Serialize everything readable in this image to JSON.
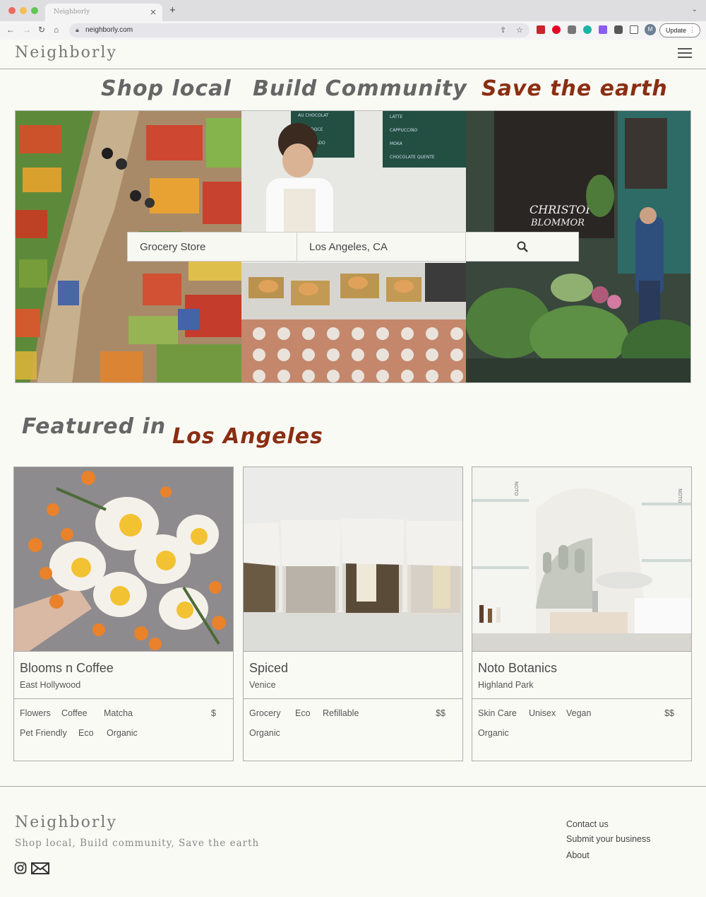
{
  "browser": {
    "tab_title": "Neighborly",
    "tab_close": "×",
    "new_tab": "+",
    "url": "neighborly.com",
    "profile_initial": "M",
    "update_label": "Update"
  },
  "header": {
    "logo": "Neighborly"
  },
  "hero": {
    "taglines": [
      {
        "text": "Shop local",
        "color": "#666666"
      },
      {
        "text": "Build Community",
        "color": "#666666"
      },
      {
        "text": "Save the earth",
        "color": "#8a2e12"
      }
    ],
    "menu_board": [
      "AU CHOCOLAT",
      "SANT DOCE",
      "AT SALGADO",
      "LATTE",
      "CAPPUCCINO",
      "MOKA",
      "CHOCOLATE QUENTE"
    ],
    "shop_sign": [
      "CHRISTOF",
      "BLOMMOR"
    ],
    "search": {
      "category": "Grocery Store",
      "location": "Los Angeles, CA"
    }
  },
  "featured": {
    "label": "Featured in",
    "city": "Los Angeles",
    "label_color": "#666666",
    "city_color": "#8a2e12",
    "cards": [
      {
        "name": "Blooms n Coffee",
        "location": "East Hollywood",
        "tags_row1": [
          "Flowers",
          "Coffee",
          "Matcha"
        ],
        "tags_row2": [
          "Pet Friendly",
          "Eco",
          "Organic"
        ],
        "price": "$"
      },
      {
        "name": "Spiced",
        "location": "Venice",
        "tags_row1": [
          "Grocery",
          "Eco",
          "Refillable"
        ],
        "tags_row2": [
          "Organic"
        ],
        "price": "$$"
      },
      {
        "name": "Noto Botanics",
        "location": "Highland Park",
        "tags_row1": [
          "Skin Care",
          "Unisex",
          "Vegan"
        ],
        "tags_row2": [
          "Organic"
        ],
        "price": "$$",
        "shelf_brand": "NOTO"
      }
    ]
  },
  "footer": {
    "logo": "Neighborly",
    "tagline": "Shop local, Build community, Save the earth",
    "links": [
      "Contact us",
      "Submit your business",
      "About"
    ]
  }
}
